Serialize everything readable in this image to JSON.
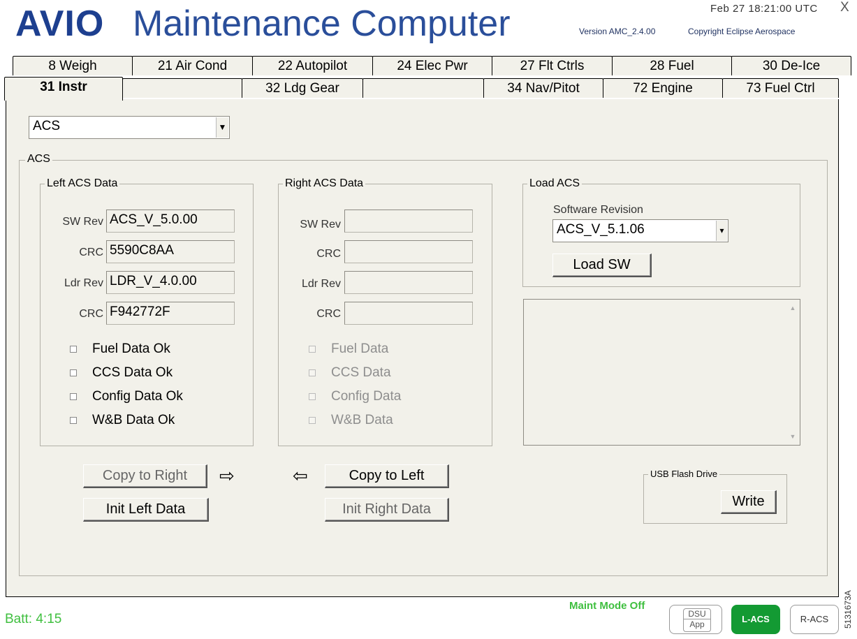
{
  "header": {
    "title_bold": "AVIO",
    "title_rest": "Maintenance Computer",
    "datetime": "Feb 27  18:21:00 UTC",
    "close_label": "X",
    "version": "Version AMC_2.4.00",
    "copyright": "Copyright Eclipse Aerospace"
  },
  "tabs": {
    "row1": [
      "8 Weigh",
      "21 Air Cond",
      "22 Autopilot",
      "24 Elec Pwr",
      "27 Flt Ctrls",
      "28 Fuel",
      "30 De-Ice"
    ],
    "row2": [
      "31 Instr",
      "",
      "32 Ldg Gear",
      "",
      "34 Nav/Pitot",
      "72 Engine",
      "73 Fuel Ctrl"
    ],
    "active": "31 Instr"
  },
  "system_select": {
    "value": "ACS"
  },
  "acs_group": {
    "label": "ACS"
  },
  "left_acs": {
    "label": "Left ACS Data",
    "sw_rev_label": "SW Rev",
    "sw_rev": "ACS_V_5.0.00",
    "crc1_label": "CRC",
    "crc1": "5590C8AA",
    "ldr_rev_label": "Ldr Rev",
    "ldr_rev": "LDR_V_4.0.00",
    "crc2_label": "CRC",
    "crc2": "F942772F",
    "checks": [
      "Fuel Data Ok",
      "CCS Data Ok",
      "Config Data Ok",
      "W&B Data Ok"
    ]
  },
  "right_acs": {
    "label": "Right ACS Data",
    "sw_rev_label": "SW Rev",
    "sw_rev": "",
    "crc1_label": "CRC",
    "crc1": "",
    "ldr_rev_label": "Ldr Rev",
    "ldr_rev": "",
    "crc2_label": "CRC",
    "crc2": "",
    "checks": [
      "Fuel Data",
      "CCS Data",
      "Config Data",
      "W&B Data"
    ]
  },
  "load_acs": {
    "label": "Load ACS",
    "software_revision_label": "Software Revision",
    "software_revision": "ACS_V_5.1.06",
    "load_button": "Load SW"
  },
  "buttons": {
    "copy_to_right": "Copy to Right",
    "copy_to_left": "Copy to Left",
    "init_left": "Init Left Data",
    "init_right": "Init Right Data",
    "arrow_right": "⇨",
    "arrow_left": "⇦"
  },
  "usb": {
    "label": "USB Flash Drive",
    "write_button": "Write"
  },
  "footer": {
    "batt": "Batt: 4:15",
    "maint_mode": "Maint Mode Off",
    "dsu_line1": "DSU",
    "dsu_line2": "App",
    "lacs": "L-ACS",
    "racs": "R-ACS",
    "figure_id": "5131673A"
  },
  "colors": {
    "title_blue": "#1d3f8f",
    "panel_bg": "#f2f1ea",
    "status_green": "#3fbf3f",
    "lacs_green": "#139a33"
  }
}
